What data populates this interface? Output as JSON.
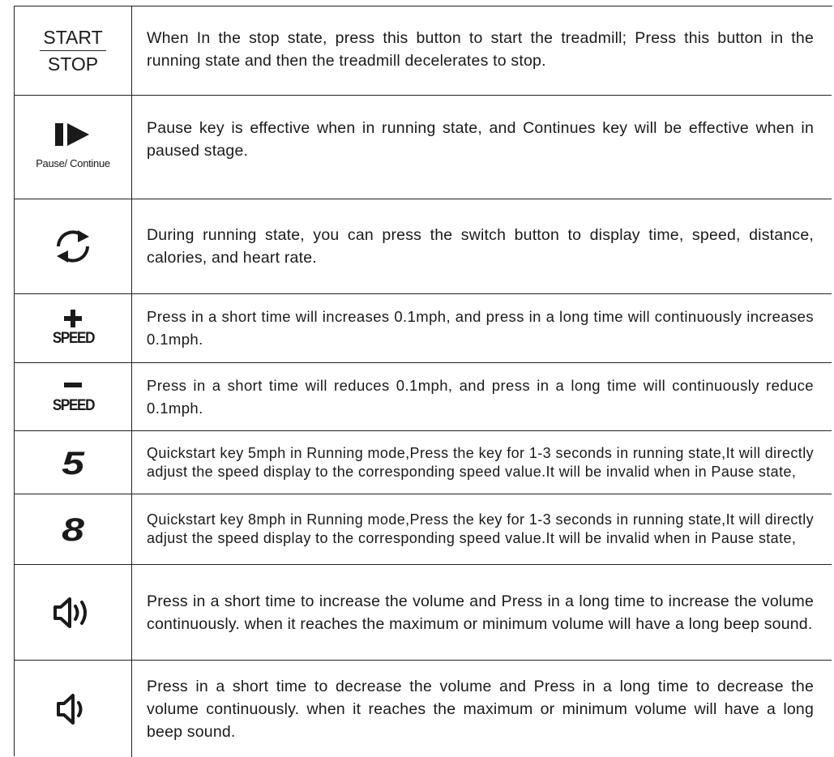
{
  "rows": [
    {
      "label_top": "START",
      "label_bottom": "STOP",
      "text": "When In the stop state, press this button to start the treadmill; Press this button in the running state and then the treadmill decelerates to stop."
    },
    {
      "icon": "pause-continue-icon",
      "label": "Pause/ Continue",
      "text": "Pause key is effective when in running state, and Continues key will be effective when in paused stage."
    },
    {
      "icon": "switch-icon",
      "text": "During running state, you can press the switch button to display time, speed, distance, calories, and heart rate."
    },
    {
      "icon": "plus-icon",
      "label": "SPEED",
      "text": "Press in a short time will increases 0.1mph, and press in a long time will continuously increases 0.1mph."
    },
    {
      "icon": "minus-icon",
      "label": "SPEED",
      "text": "Press in a short time will reduces 0.1mph, and press in a long time will continuously reduce 0.1mph."
    },
    {
      "key": "5",
      "text": "Quickstart key 5mph in Running mode,Press the key for 1-3 seconds in running state,It will directly adjust the speed display to the corresponding speed value.It will be invalid when in Pause state,"
    },
    {
      "key": "8",
      "text": "Quickstart key 8mph in Running mode,Press the key for 1-3 seconds in running state,It will directly adjust the speed display to the corresponding speed value.It will be invalid when in Pause state,"
    },
    {
      "icon": "volume-up-icon",
      "text": "Press in a short time to increase the volume and Press in a long time to increase the volume continuously. when it reaches the maximum or minimum volume will have a long beep sound."
    },
    {
      "icon": "volume-down-icon",
      "text": "Press in a short time to decrease the volume and Press in a long time to decrease the volume continuously. when it reaches the maximum or minimum volume will have a long beep sound."
    }
  ]
}
